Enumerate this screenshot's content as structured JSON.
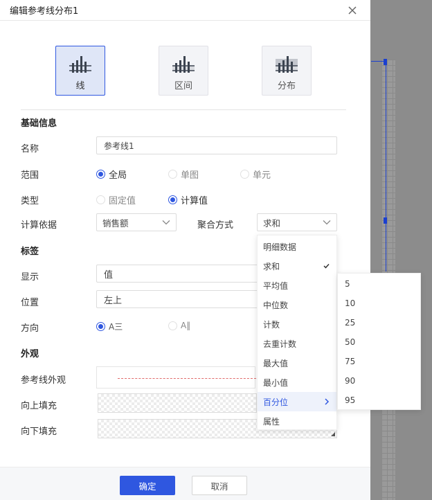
{
  "dialog": {
    "title": "编辑参考线分布1"
  },
  "type_tiles": [
    {
      "label": "线",
      "active": true
    },
    {
      "label": "区间",
      "active": false
    },
    {
      "label": "分布",
      "active": false
    }
  ],
  "basic": {
    "section": "基础信息",
    "name_label": "名称",
    "name_value": "参考线1",
    "scope_label": "范围",
    "scope_options": [
      "全局",
      "单图",
      "单元"
    ],
    "type_label": "类型",
    "type_options": [
      "固定值",
      "计算值"
    ],
    "basis_label": "计算依据",
    "basis_value": "销售额",
    "agg_label": "聚合方式",
    "agg_value": "求和"
  },
  "label_section": {
    "section": "标签",
    "display_label": "显示",
    "display_value": "值",
    "position_label": "位置",
    "position_value": "左上",
    "direction_label": "方向",
    "direction_options": [
      "A三",
      "A‖"
    ]
  },
  "appearance": {
    "section": "外观",
    "line_label": "参考线外观",
    "fill_up_label": "向上填充",
    "fill_down_label": "向下填充",
    "line_color": "#e06a6a"
  },
  "footer": {
    "ok": "确定",
    "cancel": "取消"
  },
  "agg_menu": {
    "items": [
      "明细数据",
      "求和",
      "平均值",
      "中位数",
      "计数",
      "去重计数",
      "最大值",
      "最小值",
      "百分位",
      "属性"
    ],
    "checked": "求和",
    "hover": "百分位"
  },
  "percentile_menu": {
    "items": [
      "5",
      "10",
      "25",
      "50",
      "75",
      "90",
      "95"
    ]
  },
  "colors": {
    "accent": "#2f57e0"
  }
}
